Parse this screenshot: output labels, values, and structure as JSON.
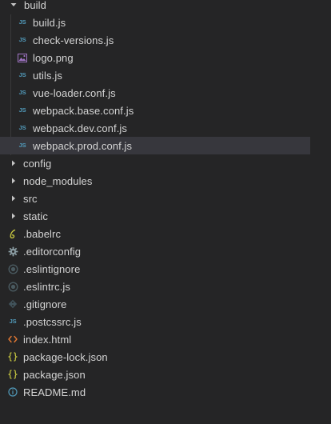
{
  "explorer": {
    "items": [
      {
        "label": "build",
        "kind": "folder",
        "state": "expanded",
        "icon": "chevron-down-icon"
      },
      {
        "label": "build.js",
        "kind": "file",
        "icon": "javascript-file-icon",
        "badge": "JS"
      },
      {
        "label": "check-versions.js",
        "kind": "file",
        "icon": "javascript-file-icon",
        "badge": "JS"
      },
      {
        "label": "logo.png",
        "kind": "file",
        "icon": "image-file-icon"
      },
      {
        "label": "utils.js",
        "kind": "file",
        "icon": "javascript-file-icon",
        "badge": "JS"
      },
      {
        "label": "vue-loader.conf.js",
        "kind": "file",
        "icon": "javascript-file-icon",
        "badge": "JS"
      },
      {
        "label": "webpack.base.conf.js",
        "kind": "file",
        "icon": "javascript-file-icon",
        "badge": "JS"
      },
      {
        "label": "webpack.dev.conf.js",
        "kind": "file",
        "icon": "javascript-file-icon",
        "badge": "JS"
      },
      {
        "label": "webpack.prod.conf.js",
        "kind": "file",
        "icon": "javascript-file-icon",
        "badge": "JS",
        "selected": true
      },
      {
        "label": "config",
        "kind": "folder",
        "state": "collapsed",
        "icon": "chevron-right-icon"
      },
      {
        "label": "node_modules",
        "kind": "folder",
        "state": "collapsed",
        "icon": "chevron-right-icon"
      },
      {
        "label": "src",
        "kind": "folder",
        "state": "collapsed",
        "icon": "chevron-right-icon"
      },
      {
        "label": "static",
        "kind": "folder",
        "state": "collapsed",
        "icon": "chevron-right-icon"
      },
      {
        "label": ".babelrc",
        "kind": "file",
        "icon": "babel-file-icon"
      },
      {
        "label": ".editorconfig",
        "kind": "file",
        "icon": "gear-icon"
      },
      {
        "label": ".eslintignore",
        "kind": "file",
        "icon": "eslint-icon"
      },
      {
        "label": ".eslintrc.js",
        "kind": "file",
        "icon": "eslint-icon"
      },
      {
        "label": ".gitignore",
        "kind": "file",
        "icon": "git-icon"
      },
      {
        "label": ".postcssrc.js",
        "kind": "file",
        "icon": "javascript-file-icon",
        "badge": "JS"
      },
      {
        "label": "index.html",
        "kind": "file",
        "icon": "html-file-icon"
      },
      {
        "label": "package-lock.json",
        "kind": "file",
        "icon": "json-file-icon"
      },
      {
        "label": "package.json",
        "kind": "file",
        "icon": "json-file-icon"
      },
      {
        "label": "README.md",
        "kind": "file",
        "icon": "info-icon"
      }
    ]
  },
  "colors": {
    "background": "#252526",
    "selection": "#37373d",
    "text": "#d4d4d4",
    "js_badge": "#519aba",
    "json": "#cbcb41",
    "html": "#e37933",
    "babel": "#cbcb41",
    "muted_icon": "#6d8086"
  }
}
